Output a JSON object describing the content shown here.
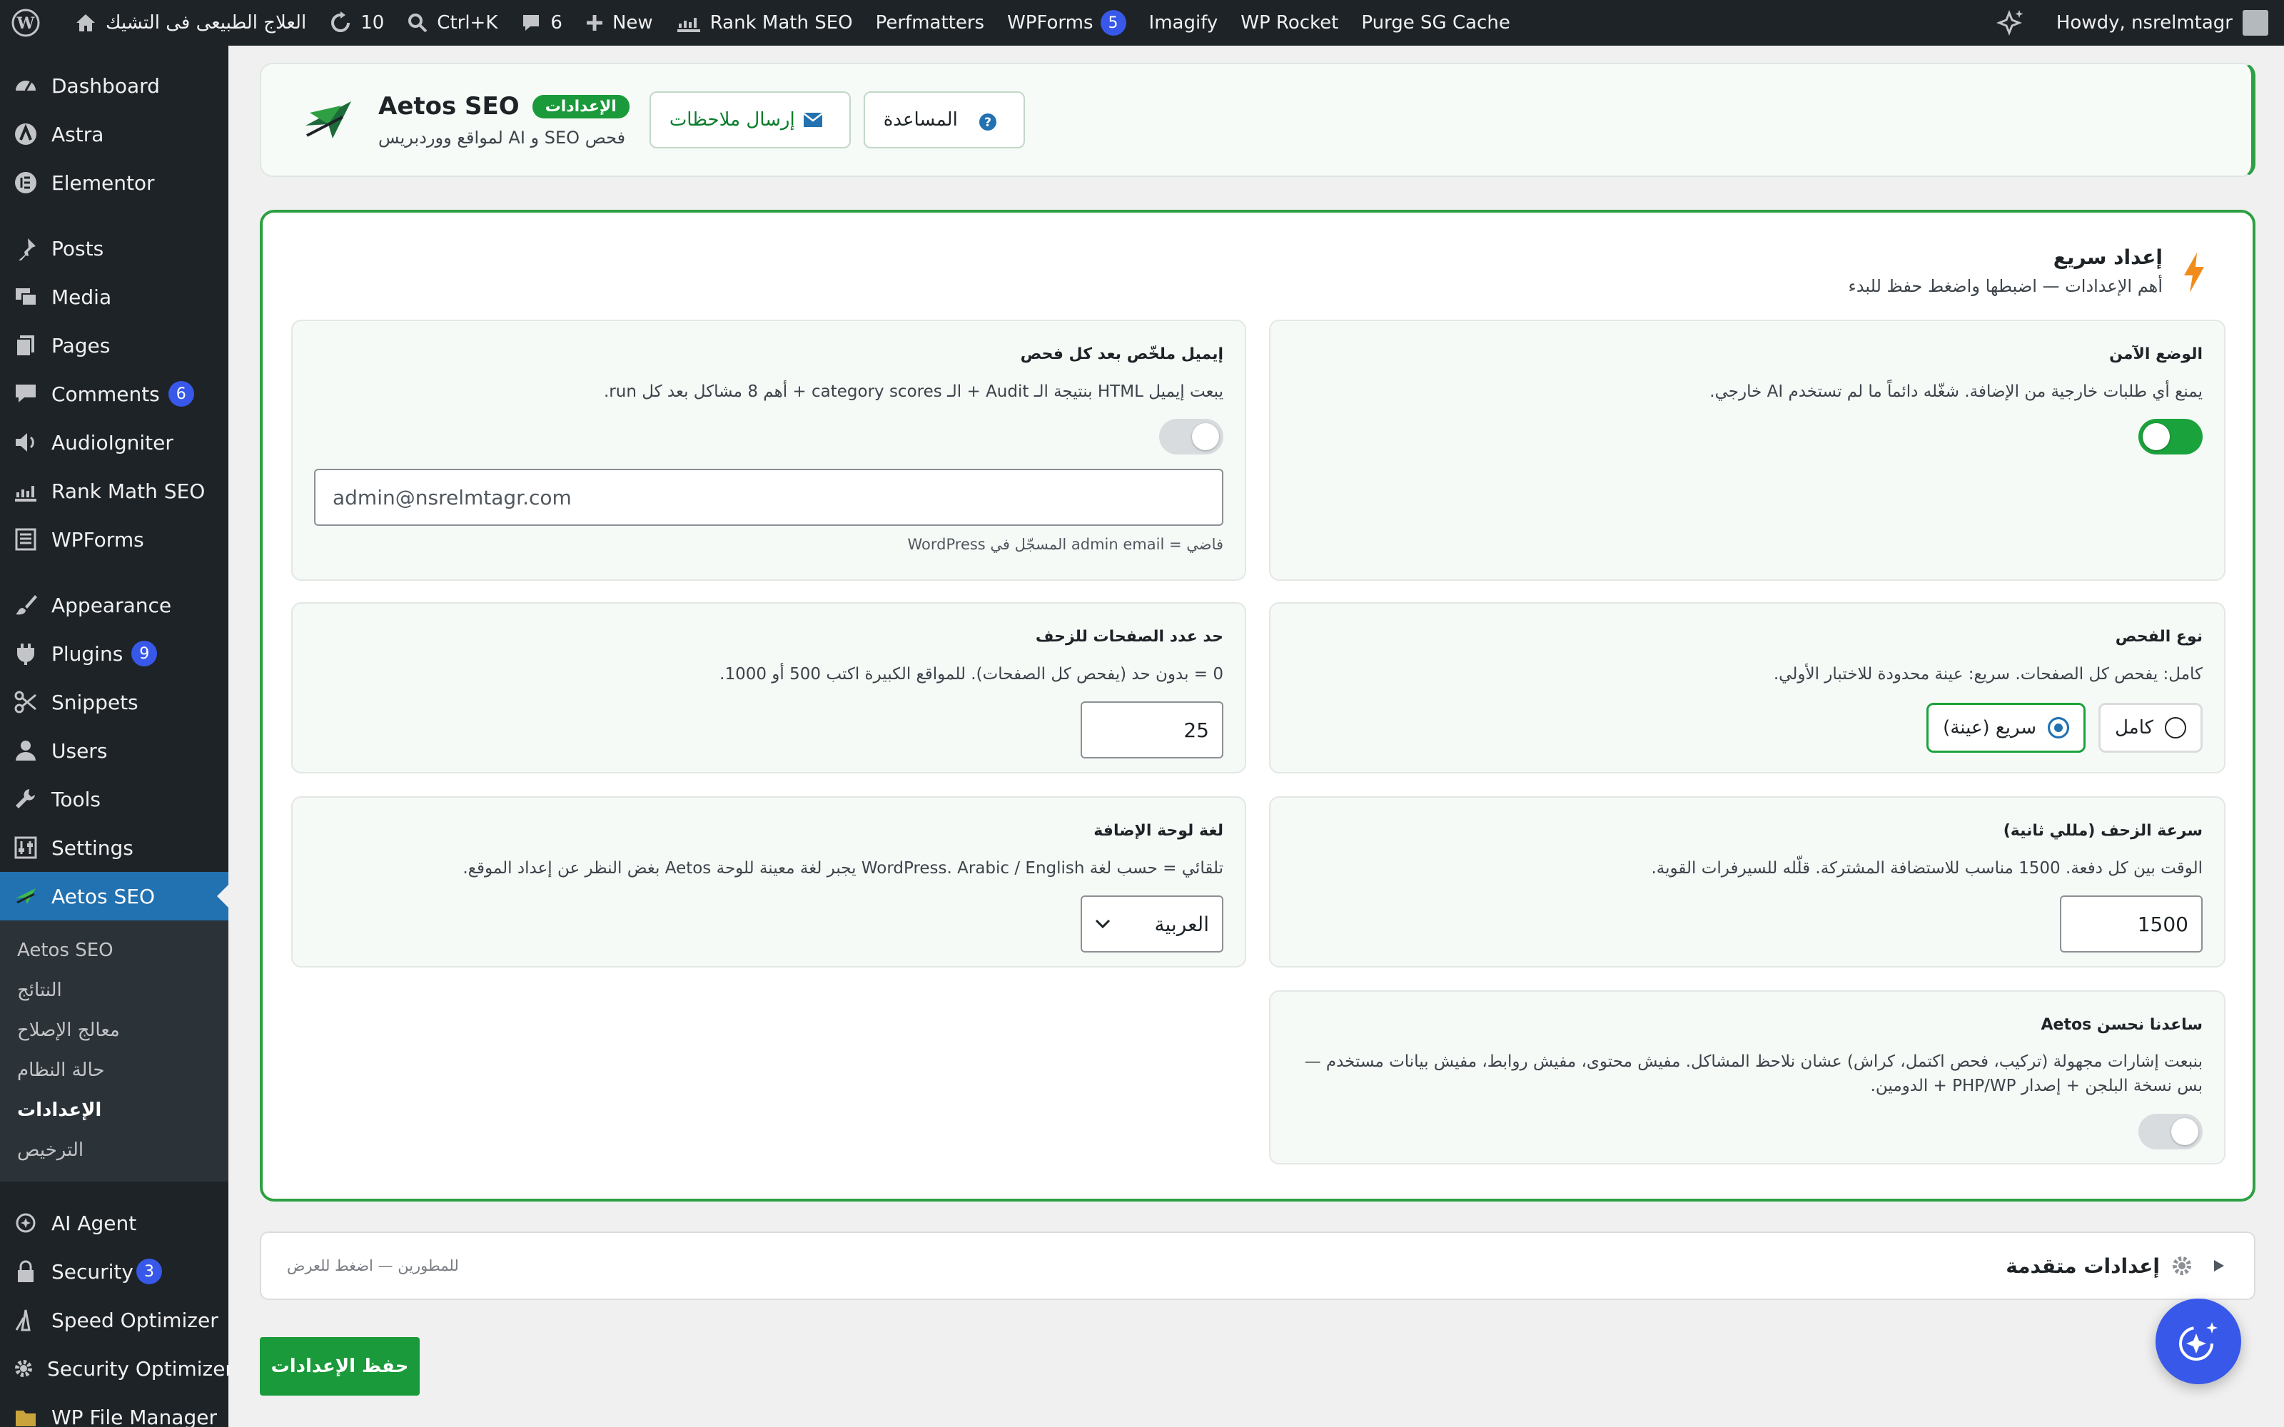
{
  "adminbar": {
    "site_name": "العلاج الطبيعى فى التشيك",
    "updates_count": "10",
    "shortcut": "Ctrl+K",
    "comments_count": "6",
    "new_label": "New",
    "items": [
      "Rank Math SEO",
      "Perfmatters",
      "WPForms",
      "Imagify",
      "WP Rocket",
      "Purge SG Cache"
    ],
    "wpforms_badge": "5",
    "howdy": "Howdy, nsrelmtagr"
  },
  "sidebar": {
    "items": [
      {
        "label": "Dashboard",
        "icon": "dashboard-icon"
      },
      {
        "label": "Astra",
        "icon": "astra-icon"
      },
      {
        "label": "Elementor",
        "icon": "elementor-icon"
      },
      {
        "label": "Posts",
        "icon": "pin-icon"
      },
      {
        "label": "Media",
        "icon": "media-icon"
      },
      {
        "label": "Pages",
        "icon": "pages-icon"
      },
      {
        "label": "Comments",
        "icon": "comment-icon",
        "badge": "6"
      },
      {
        "label": "AudioIgniter",
        "icon": "audio-icon"
      },
      {
        "label": "Rank Math SEO",
        "icon": "chart-icon"
      },
      {
        "label": "WPForms",
        "icon": "form-icon"
      },
      {
        "label": "Appearance",
        "icon": "brush-icon"
      },
      {
        "label": "Plugins",
        "icon": "plugin-icon",
        "badge": "9"
      },
      {
        "label": "Snippets",
        "icon": "scissors-icon"
      },
      {
        "label": "Users",
        "icon": "user-icon"
      },
      {
        "label": "Tools",
        "icon": "wrench-icon"
      },
      {
        "label": "Settings",
        "icon": "settings-icon"
      },
      {
        "label": "Aetos SEO",
        "icon": "aetos-icon"
      }
    ],
    "submenu": [
      "Aetos SEO",
      "النتائج",
      "معالج الإصلاح",
      "حالة النظام",
      "الإعدادات",
      "الترخيص"
    ],
    "bottom": [
      {
        "label": "AI Agent",
        "icon": "ai-icon"
      },
      {
        "label": "Security",
        "icon": "lock-icon",
        "badge": "3"
      },
      {
        "label": "Speed Optimizer",
        "icon": "speed-icon"
      },
      {
        "label": "Security Optimizer",
        "icon": "gear-icon"
      },
      {
        "label": "WP File Manager",
        "icon": "folder-icon"
      }
    ]
  },
  "header": {
    "title": "Aetos SEO",
    "badge": "الإعدادات",
    "subtitle": "فحص SEO و AI لمواقع ووردبريس",
    "feedback_label": "إرسال ملاحظات",
    "help_label": "المساعدة"
  },
  "quick_setup": {
    "title": "إعداد سريع",
    "subtitle": "أهم الإعدادات — اضبطها واضغط حفظ للبدء"
  },
  "options": {
    "safe_mode": {
      "title": "الوضع الآمن",
      "desc": "يمنع أي طلبات خارجية من الإضافة. شغّله دائماً ما لم تستخدم AI خارجي.",
      "enabled": true
    },
    "email_summary": {
      "title": "إيميل ملخّص بعد كل فحص",
      "desc": "يبعت إيميل HTML بنتيجة الـ Audit + الـ category scores + أهم 8 مشاكل بعد كل run.",
      "enabled": false,
      "placeholder": "admin@nsrelmtagr.com",
      "hint": "فاضي = admin email المسجّل في WordPress"
    },
    "scan_type": {
      "title": "نوع الفحص",
      "desc": "كامل: يفحص كل الصفحات. سريع: عينة محدودة للاختبار الأولي.",
      "option_full": "كامل",
      "option_quick": "سريع (عينة)",
      "selected": "quick"
    },
    "page_limit": {
      "title": "حد عدد الصفحات للزحف",
      "desc": "0 = بدون حد (يفحص كل الصفحات). للمواقع الكبيرة اكتب 500 أو 1000.",
      "value": "25"
    },
    "crawl_speed": {
      "title": "سرعة الزحف (مللي ثانية)",
      "desc": "الوقت بين كل دفعة. 1500 مناسب للاستضافة المشتركة. قلّله للسيرفرات القوية.",
      "value": "1500"
    },
    "panel_language": {
      "title": "لغة لوحة الإضافة",
      "desc": "تلقائي = حسب لغة WordPress. Arabic / English يجبر لغة معينة للوحة Aetos بغض النظر عن إعداد الموقع.",
      "value": "العربية"
    },
    "help_improve": {
      "title": "ساعدنا نحسن Aetos",
      "desc": "بنبعت إشارات مجهولة (تركيب، فحص اكتمل، كراش) عشان نلاحظ المشاكل. مفيش محتوى، مفيش روابط، مفيش بيانات مستخدم — بس نسخة البلجن + إصدار PHP/WP + الدومين.",
      "enabled": false
    }
  },
  "advanced": {
    "title": "إعدادات متقدمة",
    "hint": "للمطورين — اضغط للعرض"
  },
  "save_label": "حفظ الإعدادات",
  "colors": {
    "accent_green": "#1a9a3a",
    "wp_blue": "#2271b1",
    "admin_dark": "#1d2327"
  }
}
